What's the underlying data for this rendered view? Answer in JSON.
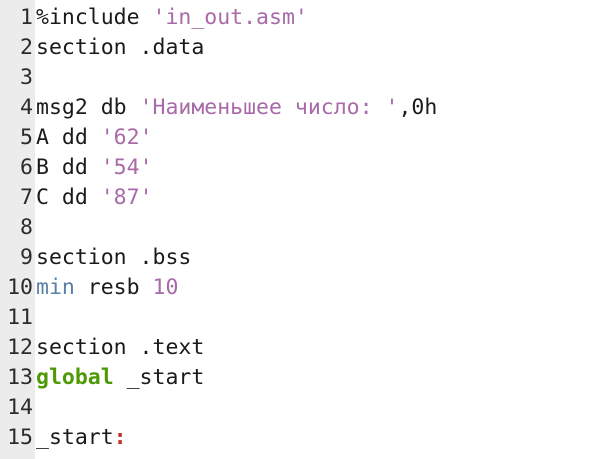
{
  "editor": {
    "lines": [
      {
        "num": "1",
        "tokens": [
          {
            "t": "%include ",
            "c": "default"
          },
          {
            "t": "'in_out.asm'",
            "c": "string"
          }
        ]
      },
      {
        "num": "2",
        "tokens": [
          {
            "t": "section .data",
            "c": "default"
          }
        ]
      },
      {
        "num": "3",
        "tokens": []
      },
      {
        "num": "4",
        "tokens": [
          {
            "t": "msg2 db ",
            "c": "default"
          },
          {
            "t": "'Наименьшее число: '",
            "c": "string"
          },
          {
            "t": ",0h",
            "c": "default"
          }
        ]
      },
      {
        "num": "5",
        "tokens": [
          {
            "t": "A dd ",
            "c": "default"
          },
          {
            "t": "'62'",
            "c": "string"
          }
        ]
      },
      {
        "num": "6",
        "tokens": [
          {
            "t": "B dd ",
            "c": "default"
          },
          {
            "t": "'54'",
            "c": "string"
          }
        ]
      },
      {
        "num": "7",
        "tokens": [
          {
            "t": "C dd ",
            "c": "default"
          },
          {
            "t": "'87'",
            "c": "string"
          }
        ]
      },
      {
        "num": "8",
        "tokens": []
      },
      {
        "num": "9",
        "tokens": [
          {
            "t": "section .bss",
            "c": "default"
          }
        ]
      },
      {
        "num": "10",
        "tokens": [
          {
            "t": "min",
            "c": "register"
          },
          {
            "t": " resb ",
            "c": "default"
          },
          {
            "t": "10",
            "c": "number"
          }
        ]
      },
      {
        "num": "11",
        "tokens": []
      },
      {
        "num": "12",
        "tokens": [
          {
            "t": "section .text",
            "c": "default"
          }
        ]
      },
      {
        "num": "13",
        "tokens": [
          {
            "t": "global",
            "c": "keyword"
          },
          {
            "t": " _start",
            "c": "default"
          }
        ]
      },
      {
        "num": "14",
        "tokens": []
      },
      {
        "num": "15",
        "tokens": [
          {
            "t": "_start",
            "c": "label"
          },
          {
            "t": ":",
            "c": "colon"
          }
        ]
      }
    ]
  },
  "colors": {
    "string": "#a86aa8",
    "keyword": "#4e9a06",
    "register": "#5a7fa8",
    "colon": "#c4302b",
    "gutter_bg": "#ececec"
  }
}
